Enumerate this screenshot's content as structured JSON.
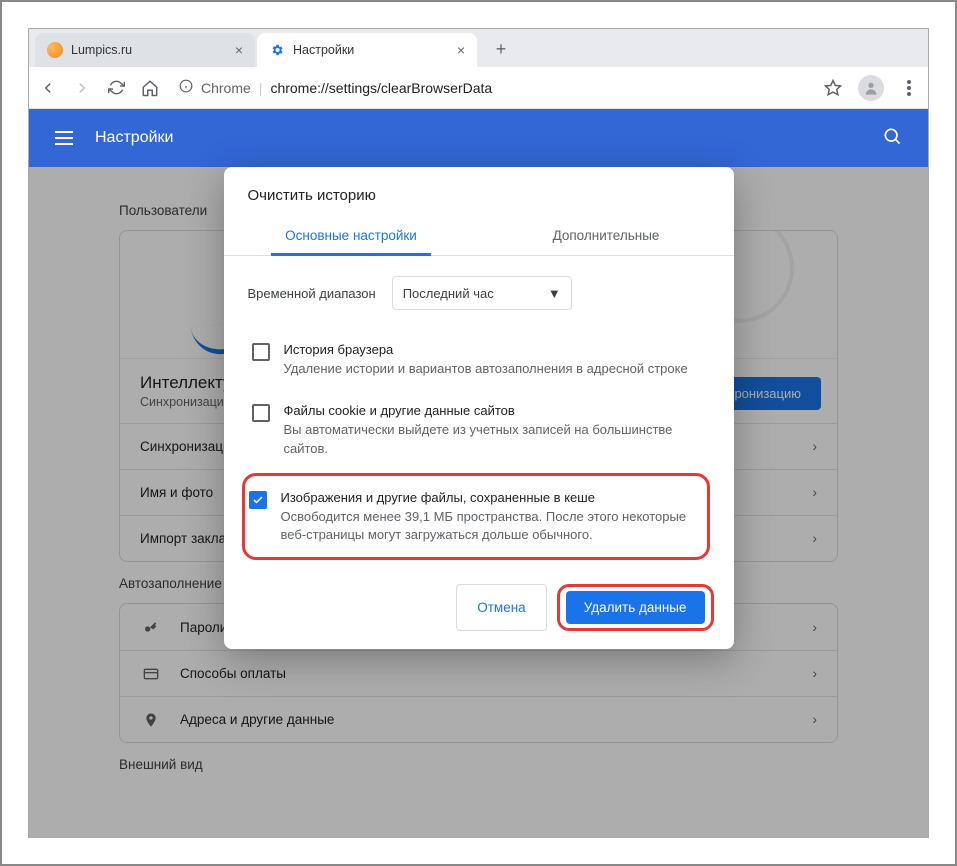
{
  "tabs": [
    {
      "title": "Lumpics.ru"
    },
    {
      "title": "Настройки"
    }
  ],
  "url": {
    "label": "Chrome",
    "path": "chrome://settings/clearBrowserData"
  },
  "header": {
    "title": "Настройки"
  },
  "sections": {
    "users": "Пользователи",
    "autofill": "Автозаполнение",
    "appearance": "Внешний вид"
  },
  "intel": {
    "title": "Интеллектуальные функции",
    "subtitle": "Синхронизация и персонализация Chrome на всех ваших устройствах",
    "button": "Включить синхронизацию"
  },
  "user_rows": [
    "Синхронизация сервисов Google",
    "Имя и фото",
    "Импорт закладок и настроек"
  ],
  "autofill_rows": [
    "Пароли",
    "Способы оплаты",
    "Адреса и другие данные"
  ],
  "dialog": {
    "title": "Очистить историю",
    "tab_basic": "Основные настройки",
    "tab_advanced": "Дополнительные",
    "time_label": "Временной диапазон",
    "time_value": "Последний час",
    "items": [
      {
        "title": "История браузера",
        "desc": "Удаление истории и вариантов автозаполнения в адресной строке",
        "checked": false
      },
      {
        "title": "Файлы cookie и другие данные сайтов",
        "desc": "Вы автоматически выйдете из учетных записей на большинстве сайтов.",
        "checked": false
      },
      {
        "title": "Изображения и другие файлы, сохраненные в кеше",
        "desc": "Освободится менее 39,1 МБ пространства. После этого некоторые веб-страницы могут загружаться дольше обычного.",
        "checked": true
      }
    ],
    "cancel": "Отмена",
    "confirm": "Удалить данные"
  }
}
